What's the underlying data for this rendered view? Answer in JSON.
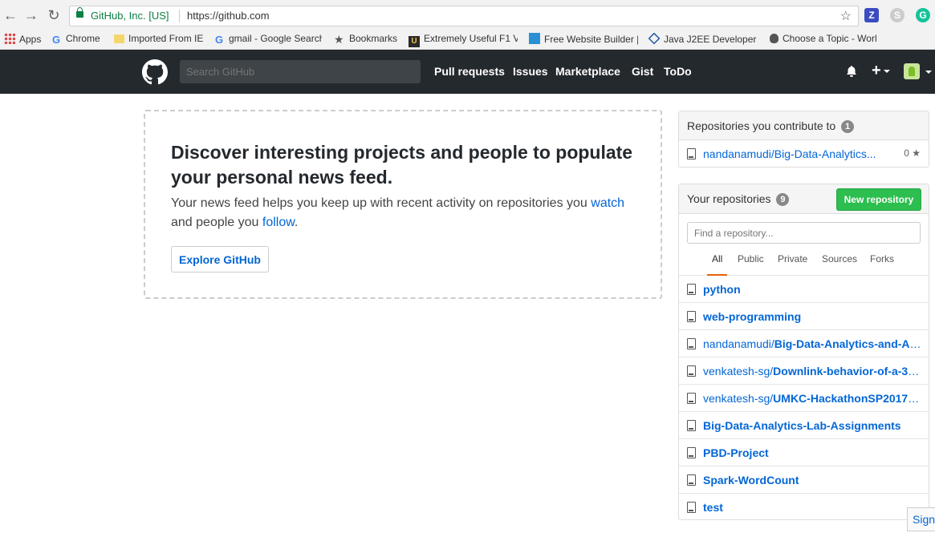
{
  "browser": {
    "site_identity": "GitHub, Inc. [US]",
    "url": "https://github.com"
  },
  "bookmarks": [
    {
      "label": "Apps",
      "icon": "apps-grid-icon"
    },
    {
      "label": "Chrome",
      "icon": "google-icon"
    },
    {
      "label": "Imported From IE",
      "icon": "folder-icon"
    },
    {
      "label": "gmail - Google Search",
      "icon": "google-icon"
    },
    {
      "label": "Bookmarks",
      "icon": "star-icon"
    },
    {
      "label": "Extremely Useful F1 V",
      "icon": "u-logo-icon"
    },
    {
      "label": "Free Website Builder |",
      "icon": "builder-icon"
    },
    {
      "label": "Java J2EE Developer a",
      "icon": "diamond-icon"
    },
    {
      "label": "Choose a Topic - Worl",
      "icon": "apple-icon"
    }
  ],
  "header": {
    "search_placeholder": "Search GitHub",
    "nav": [
      "Pull requests",
      "Issues",
      "Marketplace",
      "Gist",
      "ToDo"
    ],
    "plus_label": "+"
  },
  "blankslate": {
    "title": "Discover interesting projects and people to populate your personal news feed.",
    "text_before_watch": "Your news feed helps you keep up with recent activity on repositories you ",
    "watch_link": "watch",
    "text_middle": " and people you ",
    "follow_link": "follow",
    "text_end": ".",
    "explore_button": "Explore GitHub"
  },
  "contribute": {
    "title": "Repositories you contribute to",
    "count": "1",
    "repos": [
      {
        "owner": "nandanamudi/",
        "name": "Big-Data-Analytics...",
        "stars": "0"
      }
    ]
  },
  "your_repos": {
    "title": "Your repositories",
    "count": "9",
    "new_button": "New repository",
    "find_placeholder": "Find a repository...",
    "filters": [
      "All",
      "Public",
      "Private",
      "Sources",
      "Forks"
    ],
    "selected_filter": "All",
    "repos": [
      {
        "owner": "",
        "name": "python"
      },
      {
        "owner": "",
        "name": "web-programming"
      },
      {
        "owner": "nandanamudi/",
        "name": "Big-Data-Analytics-and-Ap..."
      },
      {
        "owner": "venkatesh-sg/",
        "name": "Downlink-behavior-of-a-3-s..."
      },
      {
        "owner": "venkatesh-sg/",
        "name": "UMKC-HackathonSP2017-Co..."
      },
      {
        "owner": "",
        "name": "Big-Data-Analytics-Lab-Assignments"
      },
      {
        "owner": "",
        "name": "PBD-Project"
      },
      {
        "owner": "",
        "name": "Spark-WordCount"
      },
      {
        "owner": "",
        "name": "test"
      }
    ]
  },
  "sign_tab": "Sign",
  "colors": {
    "header_bg": "#24292e",
    "link": "#0366d6",
    "new_repo_green": "#2cbe4e",
    "filter_underline": "#e36209"
  }
}
